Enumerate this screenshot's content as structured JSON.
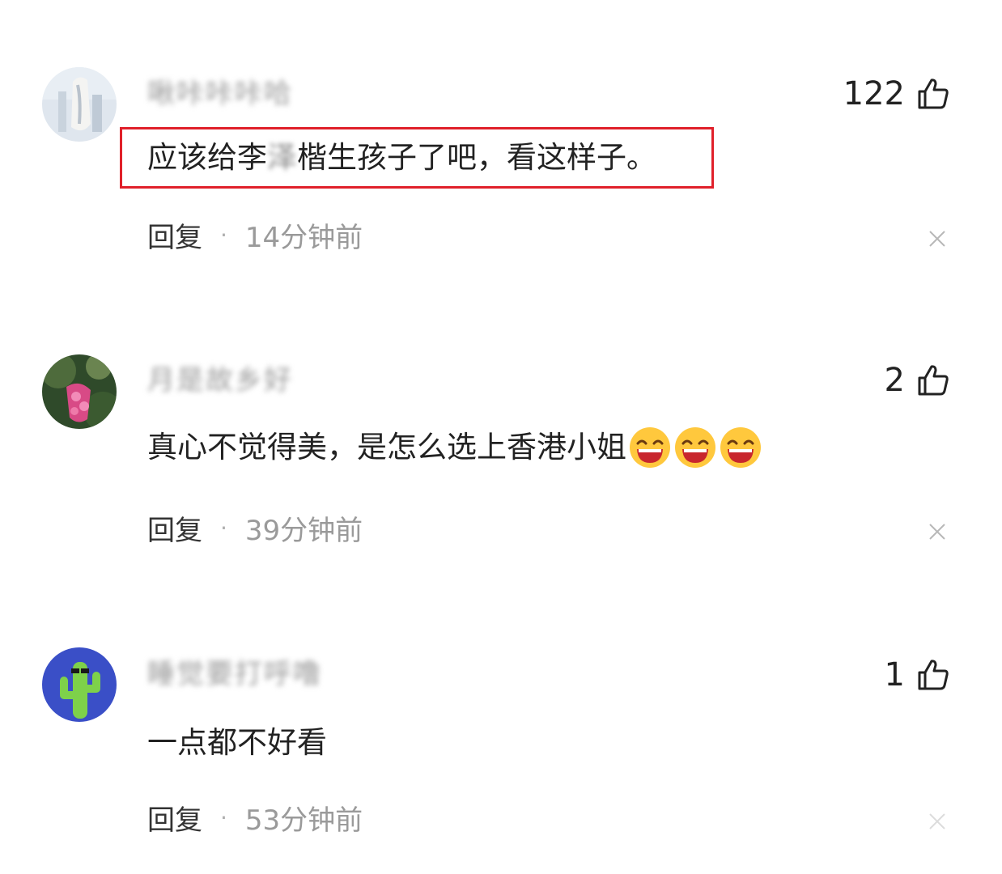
{
  "comments": [
    {
      "username": "啾咔咔咔哈",
      "like_count": "122",
      "text_before": "应该给李",
      "text_blurred": "泽",
      "text_after": "楷生孩子了吧，看这样子。",
      "emoji_count": 0,
      "reply_label": "回复",
      "separator": "·",
      "time": "14分钟前",
      "highlighted": true
    },
    {
      "username": "月是故乡好",
      "like_count": "2",
      "text_before": "真心不觉得美，是怎么选上香港小姐",
      "text_blurred": "",
      "text_after": "",
      "emoji_count": 3,
      "reply_label": "回复",
      "separator": "·",
      "time": "39分钟前",
      "highlighted": false
    },
    {
      "username": "睡觉要打呼噜",
      "like_count": "1",
      "text_before": "一点都不好看",
      "text_blurred": "",
      "text_after": "",
      "emoji_count": 0,
      "reply_label": "回复",
      "separator": "·",
      "time": "53分钟前",
      "highlighted": false
    }
  ],
  "colors": {
    "highlight_border": "#e0202a",
    "secondary_text": "#9a9a9a",
    "primary_text": "#222222"
  },
  "icons": {
    "like": "thumbs-up-icon",
    "close": "close-icon",
    "emoji": "laughing-emoji-icon"
  }
}
